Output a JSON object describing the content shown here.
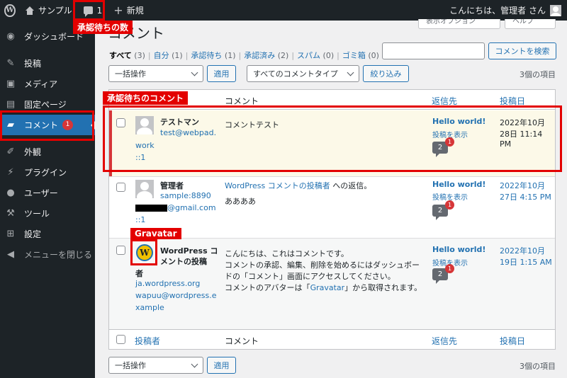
{
  "adminbar": {
    "site_name": "サンプル",
    "comment_count": "1",
    "new_label": "新規",
    "greeting": "こんにちは、管理者 さん"
  },
  "sidebar": {
    "items": [
      {
        "label": "ダッシュボード",
        "icon": "dashboard-icon"
      },
      {
        "label": "投稿",
        "icon": "pin-icon"
      },
      {
        "label": "メディア",
        "icon": "media-icon"
      },
      {
        "label": "固定ページ",
        "icon": "page-icon"
      },
      {
        "label": "コメント",
        "icon": "comment-icon",
        "badge": "1"
      },
      {
        "label": "外観",
        "icon": "brush-icon"
      },
      {
        "label": "プラグイン",
        "icon": "plugin-icon"
      },
      {
        "label": "ユーザー",
        "icon": "user-icon"
      },
      {
        "label": "ツール",
        "icon": "wrench-icon"
      },
      {
        "label": "設定",
        "icon": "settings-icon"
      },
      {
        "label": "メニューを閉じる",
        "icon": "collapse-icon"
      }
    ]
  },
  "page": {
    "title": "コメント",
    "screen_options": "表示オプション",
    "help": "ヘルプ"
  },
  "filters": {
    "all": "すべて",
    "all_count": "(3)",
    "mine": "自分",
    "mine_count": "(1)",
    "pending": "承認待ち",
    "pending_count": "(1)",
    "approved": "承認済み",
    "approved_count": "(2)",
    "spam": "スパム",
    "spam_count": "(0)",
    "trash": "ゴミ箱",
    "trash_count": "(0)",
    "sep": "|"
  },
  "search": {
    "button": "コメントを検索"
  },
  "toolbar": {
    "bulk_action": "一括操作",
    "apply": "適用",
    "comment_type": "すべてのコメントタイプ",
    "filter": "絞り込み",
    "item_count": "3個の項目"
  },
  "table": {
    "headers": {
      "author": "投稿者",
      "comment": "コメント",
      "response": "返信先",
      "date": "投稿日"
    },
    "rows": [
      {
        "author": "テストマン",
        "email_1": "test@webpad.",
        "email_2": "work",
        "ip": "::1",
        "comment": "コメントテスト",
        "response_title": "Hello world!",
        "view_post": "投稿を表示",
        "comment_bubble": "2",
        "pending_bubble": "1",
        "date_1": "2022年10月",
        "date_2": "28日 11:14",
        "date_3": "PM"
      },
      {
        "author": "管理者",
        "email_1": "sample:8890",
        "email_2": "@gmail.com",
        "ip": "::1",
        "in_reply_link": "WordPress コメントの投稿者",
        "in_reply_suffix": " への返信。",
        "comment": "ああああ",
        "response_title": "Hello world!",
        "view_post": "投稿を表示",
        "comment_bubble": "2",
        "pending_bubble": "1",
        "date_1": "2022年10月",
        "date_2": "27日 4:15 PM"
      },
      {
        "author_1": "WordPress コ",
        "author_2": "メントの投稿",
        "author_3": "者",
        "url": "ja.wordpress.org",
        "email_1": "wapuu@wordpress.e",
        "email_2": "xample",
        "gravatar_letter": "W",
        "comment_1": "こんにちは、これはコメントです。",
        "comment_2": "コメントの承認、編集、削除を始めるにはダッシュボー",
        "comment_3": "ドの「コメント」画面にアクセスしてください。",
        "comment_4a": "コメントのアバターは「",
        "comment_4b": "Gravatar",
        "comment_4c": "」から取得されます。",
        "response_title": "Hello world!",
        "view_post": "投稿を表示",
        "comment_bubble": "2",
        "pending_bubble": "1",
        "date_1": "2022年10月",
        "date_2": "19日 1:15 AM"
      }
    ]
  },
  "annotations": {
    "pending_count": "承認待ちの数",
    "pending_comment": "承認待ちのコメント",
    "gravatar": "Gravatar"
  },
  "colors": {
    "accent": "#2271b1",
    "sidebar": "#1d2327",
    "annotation": "#e30000",
    "unapproved_bg": "#fcf9e8"
  }
}
